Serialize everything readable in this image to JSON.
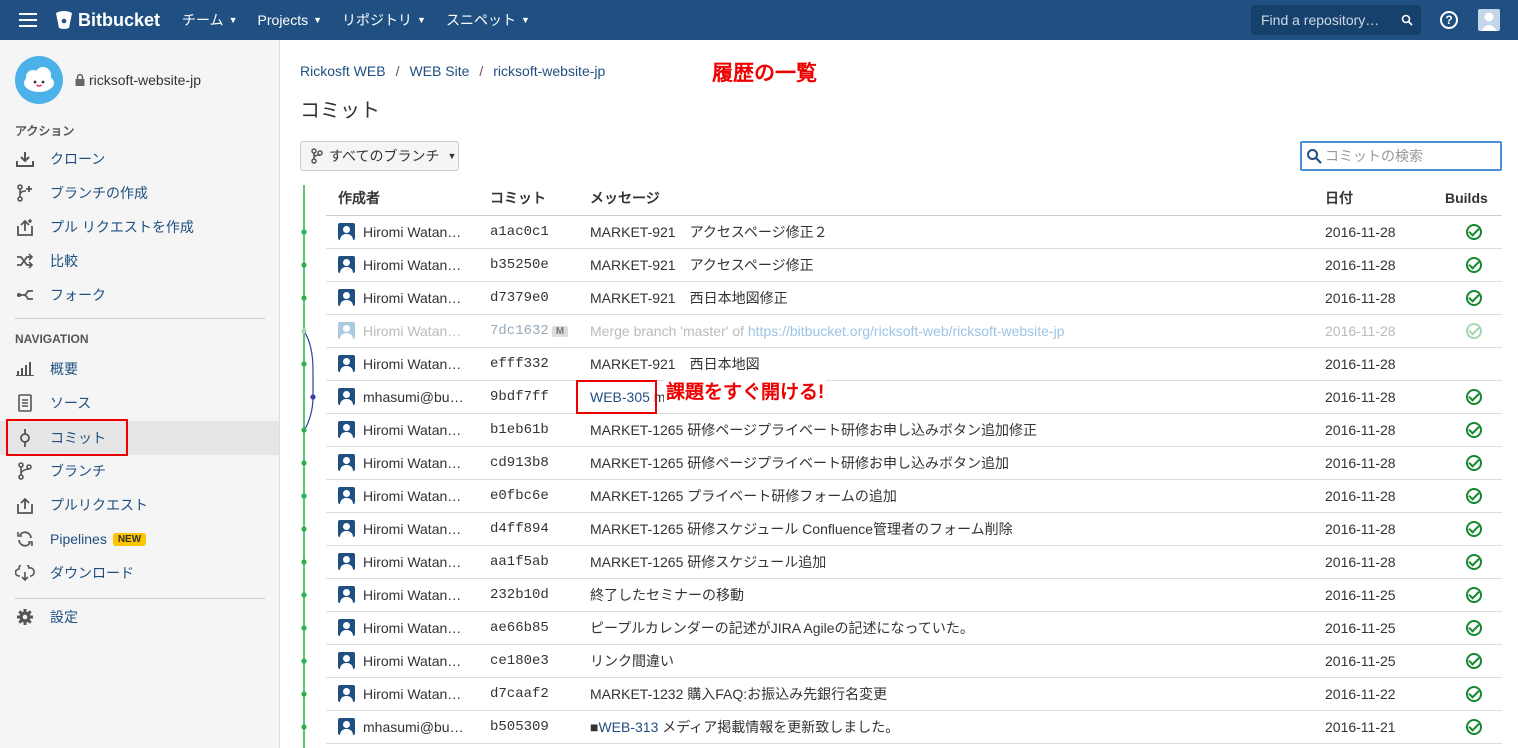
{
  "topbar": {
    "brand": "Bitbucket",
    "nav": [
      "チーム",
      "Projects",
      "リポジトリ",
      "スニペット"
    ],
    "search_placeholder": "Find a repository…",
    "help": "?"
  },
  "sidebar": {
    "repo_name": "ricksoft-website-jp",
    "actions_heading": "アクション",
    "actions": [
      {
        "label": "クローン",
        "icon": "download-icon"
      },
      {
        "label": "ブランチの作成",
        "icon": "branch-create-icon"
      },
      {
        "label": "プル リクエストを作成",
        "icon": "pull-request-create-icon"
      },
      {
        "label": "比較",
        "icon": "compare-icon"
      },
      {
        "label": "フォーク",
        "icon": "fork-icon"
      }
    ],
    "navigation_heading": "NAVIGATION",
    "navigation": [
      {
        "label": "概要",
        "icon": "overview-icon"
      },
      {
        "label": "ソース",
        "icon": "source-icon"
      },
      {
        "label": "コミット",
        "icon": "commit-icon"
      },
      {
        "label": "ブランチ",
        "icon": "branch-icon"
      },
      {
        "label": "プルリクエスト",
        "icon": "pull-request-icon"
      },
      {
        "label": "Pipelines",
        "icon": "pipelines-icon",
        "badge": "NEW"
      },
      {
        "label": "ダウンロード",
        "icon": "cloud-download-icon"
      }
    ],
    "settings": "設定"
  },
  "main": {
    "breadcrumb": [
      "Rickosft WEB",
      "WEB Site",
      "ricksoft-website-jp"
    ],
    "annotation_history": "履歴の一覧",
    "annotation_issue": "課題をすぐ開ける!",
    "title": "コミット",
    "branch_filter": "すべてのブランチ",
    "commit_search_placeholder": "コミットの検索",
    "columns": {
      "author": "作成者",
      "commit": "コミット",
      "message": "メッセージ",
      "date": "日付",
      "builds": "Builds"
    }
  },
  "commits": [
    {
      "author": "Hiromi Watan…",
      "hash": "a1ac0c1",
      "message": "MARKET-921　アクセスページ修正２",
      "date": "2016-11-28",
      "build": true
    },
    {
      "author": "Hiromi Watan…",
      "hash": "b35250e",
      "message": "MARKET-921　アクセスページ修正",
      "date": "2016-11-28",
      "build": true
    },
    {
      "author": "Hiromi Watan…",
      "hash": "d7379e0",
      "message": "MARKET-921　西日本地図修正",
      "date": "2016-11-28",
      "build": true
    },
    {
      "author": "Hiromi Watan…",
      "hash": "7dc1632",
      "merge": true,
      "merge_badge": "M",
      "message": "Merge branch 'master' of ",
      "message_link": "https://bitbucket.org/ricksoft-web/ricksoft-website-jp",
      "date": "2016-11-28",
      "build": true
    },
    {
      "author": "Hiromi Watan…",
      "hash": "efff332",
      "message": "MARKET-921　西日本地図",
      "date": "2016-11-28",
      "build": false
    },
    {
      "author": "mhasumi@bu…",
      "hash": "9bdf7ff",
      "issue": "WEB-305",
      "message": " meta記修正いたしました。",
      "date": "2016-11-28",
      "build": true
    },
    {
      "author": "Hiromi Watan…",
      "hash": "b1eb61b",
      "message": "MARKET-1265 研修ページプライベート研修お申し込みボタン追加修正",
      "date": "2016-11-28",
      "build": true
    },
    {
      "author": "Hiromi Watan…",
      "hash": "cd913b8",
      "message": "MARKET-1265 研修ページプライベート研修お申し込みボタン追加",
      "date": "2016-11-28",
      "build": true
    },
    {
      "author": "Hiromi Watan…",
      "hash": "e0fbc6e",
      "message": "MARKET-1265 プライベート研修フォームの追加",
      "date": "2016-11-28",
      "build": true
    },
    {
      "author": "Hiromi Watan…",
      "hash": "d4ff894",
      "message": "MARKET-1265 研修スケジュール Confluence管理者のフォーム削除",
      "date": "2016-11-28",
      "build": true
    },
    {
      "author": "Hiromi Watan…",
      "hash": "aa1f5ab",
      "message": "MARKET-1265 研修スケジュール追加",
      "date": "2016-11-28",
      "build": true
    },
    {
      "author": "Hiromi Watan…",
      "hash": "232b10d",
      "message": "終了したセミナーの移動",
      "date": "2016-11-25",
      "build": true
    },
    {
      "author": "Hiromi Watan…",
      "hash": "ae66b85",
      "message": "ピープルカレンダーの記述がJIRA Agileの記述になっていた。",
      "date": "2016-11-25",
      "build": true
    },
    {
      "author": "Hiromi Watan…",
      "hash": "ce180e3",
      "message": "リンク間違い",
      "date": "2016-11-25",
      "build": true
    },
    {
      "author": "Hiromi Watan…",
      "hash": "d7caaf2",
      "message": "MARKET-1232 購入FAQ:お振込み先銀行名変更",
      "date": "2016-11-22",
      "build": true
    },
    {
      "author": "mhasumi@bu…",
      "hash": "b505309",
      "prefix": "■",
      "issue": "WEB-313",
      "message": " メディア掲載情報を更新致しました。",
      "date": "2016-11-21",
      "build": true
    }
  ]
}
